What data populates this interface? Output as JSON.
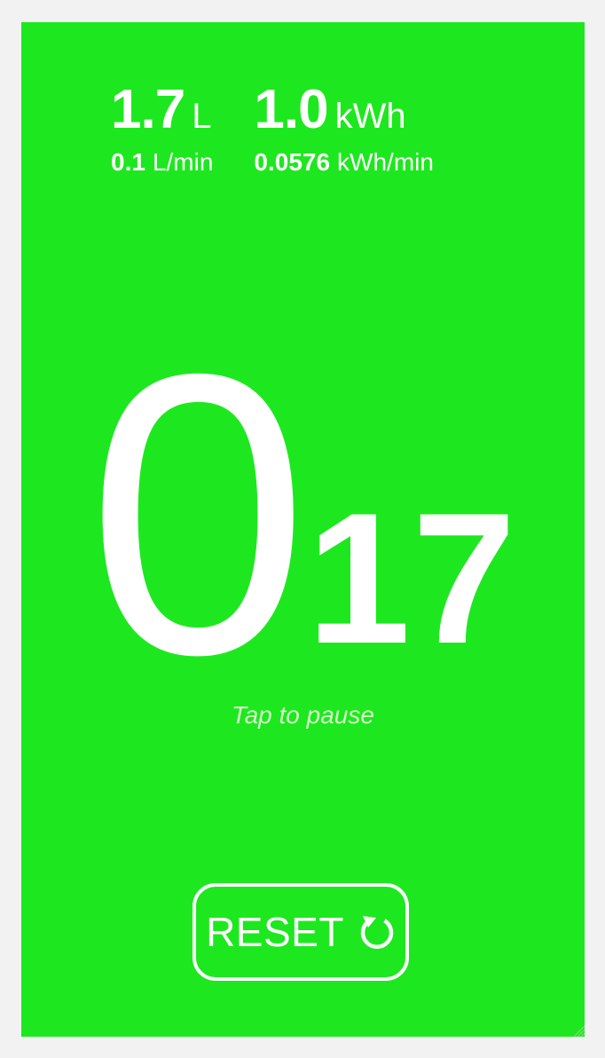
{
  "stats": {
    "volume": {
      "value": "1.7",
      "unit": "L"
    },
    "energy": {
      "value": "1.0",
      "unit": "kWh"
    },
    "flow_rate": {
      "value": "0.1",
      "unit": "L/min"
    },
    "power_rate": {
      "value": "0.0576",
      "unit": "kWh/min"
    }
  },
  "timer": {
    "major": "0",
    "minor": "17"
  },
  "hint": "Tap to pause",
  "reset_button": {
    "label": "RESET",
    "icon": "refresh-icon"
  },
  "colors": {
    "background": "#1de81f",
    "text": "#ffffff",
    "page": "#f2f2f2"
  }
}
